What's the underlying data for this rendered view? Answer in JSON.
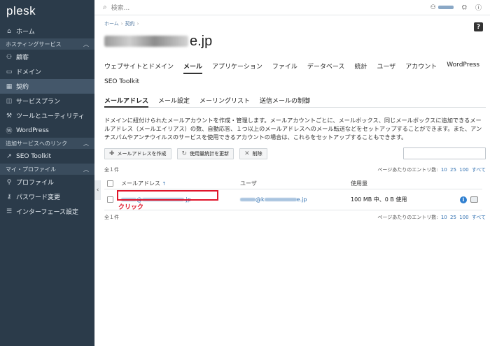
{
  "app": {
    "logo": "plesk"
  },
  "sidebar": {
    "items_top": [
      {
        "label": "ホーム",
        "icon": "home-icon"
      }
    ],
    "section_hosting": "ホスティングサービス",
    "hosting_items": [
      {
        "label": "顧客",
        "icon": "users-icon"
      },
      {
        "label": "ドメイン",
        "icon": "monitor-icon"
      },
      {
        "label": "契約",
        "icon": "grid-icon"
      },
      {
        "label": "サービスプラン",
        "icon": "plans-icon"
      },
      {
        "label": "ツールとユーティリティ",
        "icon": "tools-icon"
      },
      {
        "label": "WordPress",
        "icon": "wordpress-icon"
      }
    ],
    "section_links": "追加サービスへのリンク",
    "link_items": [
      {
        "label": "SEO Toolkit",
        "icon": "seo-icon"
      }
    ],
    "section_profile": "マイ・プロファイル",
    "profile_items": [
      {
        "label": "プロファイル",
        "icon": "person-icon"
      },
      {
        "label": "パスワード変更",
        "icon": "key-icon"
      },
      {
        "label": "インターフェース設定",
        "icon": "settings-icon"
      }
    ]
  },
  "topbar": {
    "search_placeholder": "検索..."
  },
  "help_badge": "?",
  "breadcrumb": {
    "home": "ホーム",
    "subscriptions": "契約"
  },
  "page": {
    "title_suffix": "e.jp"
  },
  "tabs": [
    "ウェブサイトとドメイン",
    "メール",
    "アプリケーション",
    "ファイル",
    "データベース",
    "統計",
    "ユーザ",
    "アカウント",
    "WordPress",
    "SEO Toolkit"
  ],
  "active_tab": "メール",
  "subtabs": [
    "メールアドレス",
    "メール設定",
    "メーリングリスト",
    "送信メールの制御"
  ],
  "description": "ドメインに紐付けられたメールアカウントを作成・管理します。メールアカウントごとに、メールボックス、同じメールボックスに追加できるメールアドレス（メールエイリアス）の数、自動応答、１つ以上のメールアドレスへのメール転送などをセットアップすることができます。また、アンチスパムやアンチウイルスのサービスを使用できるアカウントの場合は、これらをセットアップすることもできます。",
  "toolbar": {
    "create": "メールアドレスを作成",
    "update_stats": "使用量統計を更新",
    "delete": "削除"
  },
  "list": {
    "total": "全１件",
    "per_page_label": "ページあたりのエントリ数:",
    "per_page_options": [
      "10",
      "25",
      "100",
      "すべて"
    ],
    "columns": {
      "email": "メールアドレス",
      "user": "ユーザ",
      "usage": "使用量"
    },
    "sort_indicator": "↑",
    "rows": [
      {
        "email_suffix": "@",
        "email_tail": ".jp",
        "user_mid": "@k",
        "user_tail": "e.jp",
        "usage": "100 MB 中、0 B 使用"
      }
    ]
  },
  "annotation": {
    "click_label": "クリック",
    "color": "#e0162b"
  }
}
